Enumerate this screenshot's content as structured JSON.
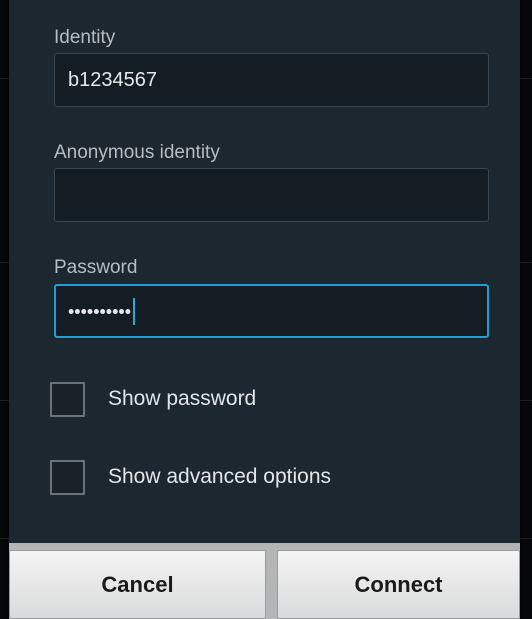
{
  "identity": {
    "label": "Identity",
    "value": "b1234567"
  },
  "anonymous_identity": {
    "label": "Anonymous identity",
    "value": ""
  },
  "password": {
    "label": "Password",
    "masked_value": "••••••••••"
  },
  "show_password": {
    "label": "Show password",
    "checked": false
  },
  "show_advanced": {
    "label": "Show advanced options",
    "checked": false
  },
  "buttons": {
    "cancel": "Cancel",
    "connect": "Connect"
  },
  "colors": {
    "dialog_bg": "#1c2730",
    "focus_accent": "#1f9fd3",
    "button_bg": "#e9eaea"
  }
}
